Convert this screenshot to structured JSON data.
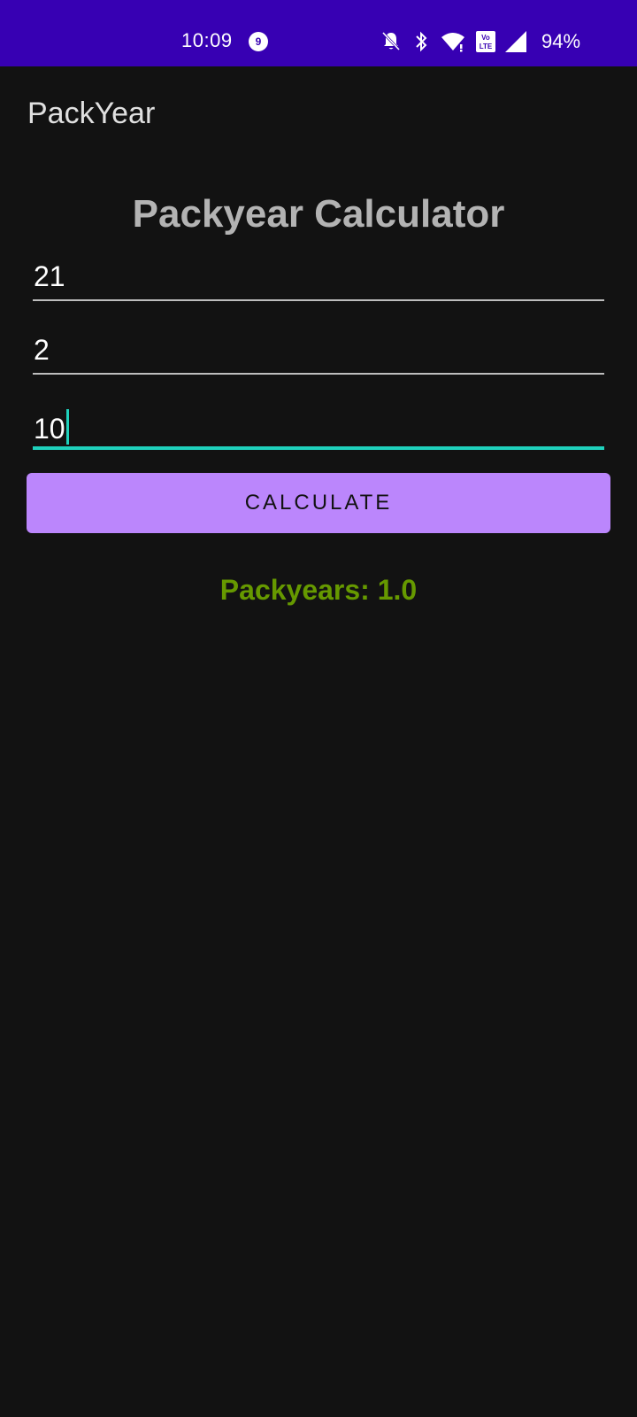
{
  "status_bar": {
    "time": "10:09",
    "notification_count": "9",
    "battery": "94%",
    "icons": [
      "bell-off-icon",
      "bluetooth-icon",
      "wifi-icon",
      "volte-icon",
      "signal-icon"
    ],
    "background_color": "#3700b3"
  },
  "app_bar": {
    "title": "PackYear"
  },
  "main": {
    "heading": "Packyear Calculator",
    "fields": [
      {
        "value": "21"
      },
      {
        "value": "2"
      },
      {
        "value": "10"
      }
    ],
    "calculate_label": "CALCULATE",
    "result_text": "Packyears: 1.0"
  },
  "colors": {
    "accent": "#1fd1bc",
    "button": "#bb86fc",
    "result": "#669900",
    "background": "#121212"
  }
}
